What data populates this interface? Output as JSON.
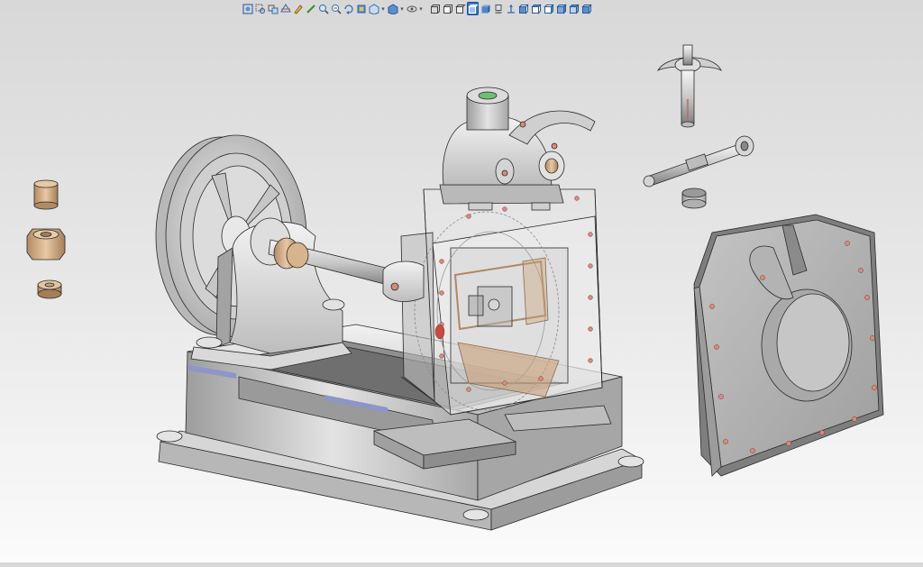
{
  "app": {
    "window_title": "",
    "colors": {
      "background_top": "#d8d8d8",
      "background_bottom": "#fbfbfb",
      "metal_light": "#e6e6e6",
      "metal_mid": "#bcbcbc",
      "metal_dark": "#8f8f8f",
      "edge": "#2a2a2a",
      "brass": "#c9a27a",
      "bolt_red": "#c2675a",
      "highlight_active": "#3b78c8",
      "inlet_green": "#6fbf73"
    }
  },
  "toolbar": {
    "items": [
      {
        "icon": "zoom-fit-icon",
        "kind": "button"
      },
      {
        "icon": "zoom-area-icon",
        "kind": "button"
      },
      {
        "icon": "previous-view-icon",
        "kind": "button"
      },
      {
        "icon": "section-view-icon",
        "kind": "button"
      },
      {
        "icon": "dynamic-annotation-icon",
        "kind": "button"
      },
      {
        "icon": "sketch-pen-icon",
        "kind": "button"
      },
      {
        "icon": "zoom-icon",
        "kind": "button"
      },
      {
        "icon": "zoom-in-icon",
        "kind": "button"
      },
      {
        "icon": "rotate-view-icon",
        "kind": "button"
      },
      {
        "icon": "pan-view-icon",
        "kind": "button"
      },
      {
        "icon": "view-orientation-icon",
        "kind": "dropdown"
      },
      {
        "icon": "display-style-icon",
        "kind": "dropdown"
      },
      {
        "icon": "hide-show-items-icon",
        "kind": "dropdown"
      },
      {
        "icon": "wireframe-icon",
        "kind": "button"
      },
      {
        "icon": "hidden-lines-visible-icon",
        "kind": "button"
      },
      {
        "icon": "hidden-lines-removed-icon",
        "kind": "button"
      },
      {
        "icon": "shaded-with-edges-icon",
        "kind": "button",
        "active": true
      },
      {
        "icon": "shaded-icon",
        "kind": "button"
      },
      {
        "icon": "shadows-icon",
        "kind": "button"
      },
      {
        "icon": "perspective-icon",
        "kind": "button"
      },
      {
        "icon": "front-view-icon",
        "kind": "button"
      },
      {
        "icon": "top-view-icon",
        "kind": "button"
      },
      {
        "icon": "right-view-icon",
        "kind": "button"
      },
      {
        "icon": "isometric-view-icon",
        "kind": "button"
      },
      {
        "icon": "trimetric-view-icon",
        "kind": "button"
      },
      {
        "icon": "dimetric-view-icon",
        "kind": "button"
      }
    ]
  },
  "model": {
    "name": "",
    "parts": [
      {
        "id": "flywheel",
        "label": ""
      },
      {
        "id": "crankshaft",
        "label": ""
      },
      {
        "id": "bearing-support",
        "label": ""
      },
      {
        "id": "base-frame",
        "label": ""
      },
      {
        "id": "cylinder-block",
        "label": ""
      },
      {
        "id": "valve-head",
        "label": ""
      },
      {
        "id": "cover-plate",
        "label": ""
      },
      {
        "id": "piston-rod",
        "label": ""
      },
      {
        "id": "connecting-rod",
        "label": ""
      },
      {
        "id": "knurled-nut",
        "label": ""
      },
      {
        "id": "bushing",
        "label": ""
      },
      {
        "id": "hex-nut",
        "label": ""
      },
      {
        "id": "washer",
        "label": ""
      }
    ]
  }
}
